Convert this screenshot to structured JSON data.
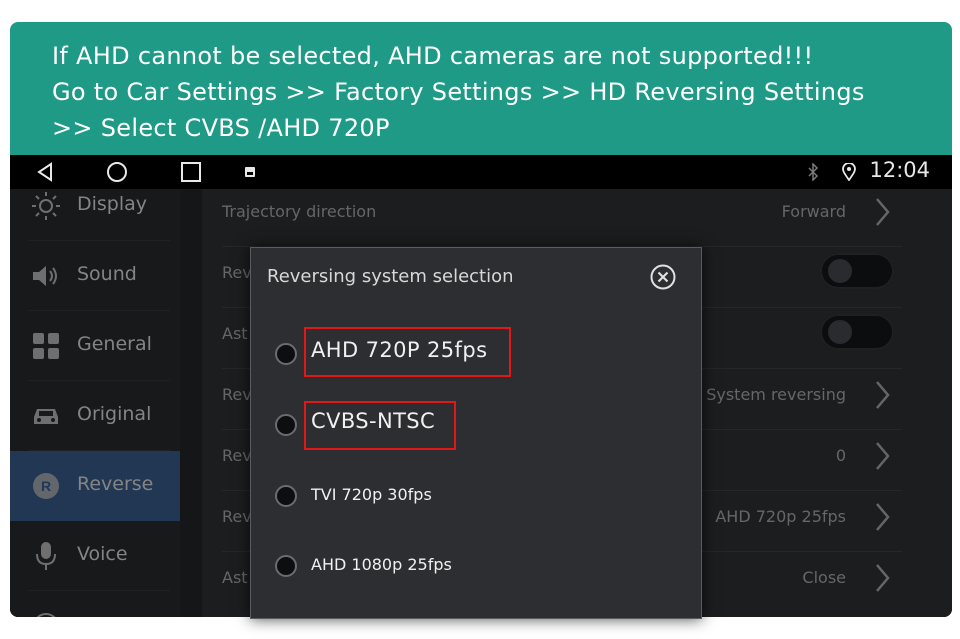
{
  "banner": {
    "line1": "If AHD cannot be selected, AHD cameras are not supported!!!",
    "line2": "Go to Car Settings >> Factory Settings >> HD Reversing Settings",
    "line3": ">> Select CVBS /AHD 720P"
  },
  "statusbar": {
    "time": "12:04"
  },
  "sidebar": {
    "items": [
      {
        "label": "Display",
        "icon": "sun-icon"
      },
      {
        "label": "Sound",
        "icon": "speaker-icon"
      },
      {
        "label": "General",
        "icon": "grid-icon"
      },
      {
        "label": "Original",
        "icon": "car-icon"
      },
      {
        "label": "Reverse",
        "icon": "reverse-r-icon",
        "active": true
      },
      {
        "label": "Voice",
        "icon": "microphone-icon"
      }
    ]
  },
  "settings": {
    "rows": [
      {
        "label": "Trajectory direction",
        "value": "Forward"
      },
      {
        "label": "Rev",
        "value": "",
        "toggle": true
      },
      {
        "label": "Ast",
        "value": "",
        "toggle": true
      },
      {
        "label": "Rev",
        "value": "System reversing"
      },
      {
        "label": "Rev",
        "value": "0"
      },
      {
        "label": "Rev",
        "value": "AHD 720p 25fps"
      },
      {
        "label": "Ast",
        "value": "Close"
      }
    ]
  },
  "dialog": {
    "title": "Reversing system selection",
    "options": [
      {
        "label": "AHD 720P 25fps",
        "highlighted": true
      },
      {
        "label": "CVBS-NTSC",
        "highlighted": true
      },
      {
        "label": "TVI 720p 30fps",
        "highlighted": false
      },
      {
        "label": "AHD 1080p 25fps",
        "highlighted": false
      }
    ]
  },
  "colors": {
    "banner": "#1e9a86",
    "highlight": "#e01818",
    "active_sidebar": "#2f4d73"
  }
}
